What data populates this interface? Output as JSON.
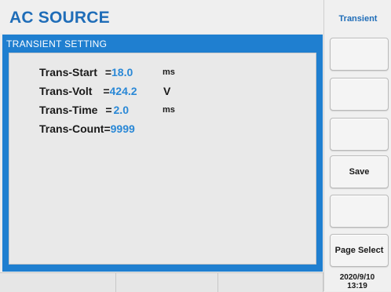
{
  "header": {
    "title": "AC SOURCE"
  },
  "panel": {
    "title": "TRANSIENT SETTING"
  },
  "params": [
    {
      "name": "Trans-Start",
      "value": "18.0",
      "unit": "ms"
    },
    {
      "name": "Trans-Volt",
      "value": "424.2",
      "unit": "V"
    },
    {
      "name": "Trans-Time",
      "value": "2.0",
      "unit": "ms"
    },
    {
      "name": "Trans-Count",
      "value": "9999",
      "unit": ""
    }
  ],
  "sidebar": {
    "mode_label": "Transient",
    "keys": [
      "",
      "",
      "",
      "Save",
      "",
      "Page Select"
    ]
  },
  "footer": {
    "date": "2020/9/10",
    "time": "13:19"
  },
  "colors": {
    "accent": "#1f7fd0",
    "title": "#1f6db8",
    "value": "#2a88d6"
  }
}
